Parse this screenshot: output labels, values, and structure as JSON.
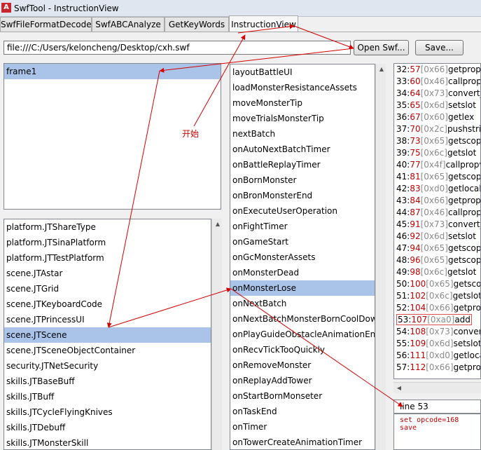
{
  "window": {
    "title": "SwfTool - InstructionView",
    "icon": "swf-app-icon"
  },
  "tabs": [
    {
      "label": "SwfFileFormatDecode",
      "active": false
    },
    {
      "label": "SwfABCAnalyze",
      "active": false
    },
    {
      "label": "GetKeyWords",
      "active": false
    },
    {
      "label": "InstructionView",
      "active": true
    }
  ],
  "toolbar": {
    "path_value": "file:///C:/Users/keloncheng/Desktop/cxh.swf",
    "open_label": "Open Swf...",
    "save_label": "Save..."
  },
  "frames": {
    "items": [
      "frame1"
    ],
    "selected_index": 0
  },
  "classes": {
    "items": [
      "platform.JTShareType",
      "platform.JTSinaPlatform",
      "platform.JTTestPlatform",
      "scene.JTAstar",
      "scene.JTGrid",
      "scene.JTKeyboardCode",
      "scene.JTPrincessUI",
      "scene.JTScene",
      "scene.JTSceneObjectContainer",
      "security.JTNetSecurity",
      "skills.JTBaseBuff",
      "skills.JTBuff",
      "skills.JTCycleFlyingKnives",
      "skills.JTDebuff",
      "skills.JTMonsterSkill"
    ],
    "selected_index": 7
  },
  "methods": {
    "items": [
      "layoutBattleUI",
      "loadMonsterResistanceAssets",
      "moveMonsterTip",
      "moveTrialsMonsterTip",
      "nextBatch",
      "onAutoNextBatchTimer",
      "onBattleReplayTimer",
      "onBornMonster",
      "onBronMonsterEnd",
      "onExecuteUserOperation",
      "onFightTimer",
      "onGameStart",
      "onGcMonsterAssets",
      "onMonsterDead",
      "onMonsterLose",
      "onNextBatch",
      "onNextBatchMonsterBornCoolDownT",
      "onPlayGuideObstacleAnimationEnd",
      "onRecvTickTooQuickly",
      "onRemoveMonster",
      "onReplayAddTower",
      "onStartBornMonseter",
      "onTaskEnd",
      "onTimer",
      "onTowerCreateAnimationTimer"
    ],
    "selected_index": 14
  },
  "instructions": [
    {
      "line": "32",
      "offset": "57",
      "opcode": "[0x66]",
      "name": "getproperty"
    },
    {
      "line": "33",
      "offset": "60",
      "opcode": "[0x46]",
      "name": "callproperty"
    },
    {
      "line": "34",
      "offset": "64",
      "opcode": "[0x73]",
      "name": "convert_i"
    },
    {
      "line": "35",
      "offset": "65",
      "opcode": "[0x6d]",
      "name": "setslot"
    },
    {
      "line": "36",
      "offset": "67",
      "opcode": "[0x60]",
      "name": "getlex"
    },
    {
      "line": "37",
      "offset": "70",
      "opcode": "[0x2c]",
      "name": "pushstring"
    },
    {
      "line": "38",
      "offset": "73",
      "opcode": "[0x65]",
      "name": "getscopeobject"
    },
    {
      "line": "39",
      "offset": "75",
      "opcode": "[0x6c]",
      "name": "getslot"
    },
    {
      "line": "40",
      "offset": "77",
      "opcode": "[0x4f]",
      "name": "callpropvoid"
    },
    {
      "line": "41",
      "offset": "81",
      "opcode": "[0x65]",
      "name": "getscopeobject"
    },
    {
      "line": "42",
      "offset": "83",
      "opcode": "[0xd0]",
      "name": "getlocal_n"
    },
    {
      "line": "43",
      "offset": "84",
      "opcode": "[0x66]",
      "name": "getproperty"
    },
    {
      "line": "44",
      "offset": "87",
      "opcode": "[0x46]",
      "name": "callproperty"
    },
    {
      "line": "45",
      "offset": "91",
      "opcode": "[0x73]",
      "name": "convert_i"
    },
    {
      "line": "46",
      "offset": "92",
      "opcode": "[0x6d]",
      "name": "setslot"
    },
    {
      "line": "47",
      "offset": "94",
      "opcode": "[0x65]",
      "name": "getscopeobject"
    },
    {
      "line": "48",
      "offset": "96",
      "opcode": "[0x65]",
      "name": "getscopeobject"
    },
    {
      "line": "49",
      "offset": "98",
      "opcode": "[0x6c]",
      "name": "getslot"
    },
    {
      "line": "50",
      "offset": "100",
      "opcode": "[0x65]",
      "name": "getscopeobject"
    },
    {
      "line": "51",
      "offset": "102",
      "opcode": "[0x6c]",
      "name": "getslot"
    },
    {
      "line": "52",
      "offset": "104",
      "opcode": "[0x66]",
      "name": "getproperty"
    },
    {
      "line": "53",
      "offset": "107",
      "opcode": "[0xa0]",
      "name": "add"
    },
    {
      "line": "54",
      "offset": "108",
      "opcode": "[0x73]",
      "name": "convert_i"
    },
    {
      "line": "55",
      "offset": "109",
      "opcode": "[0x6d]",
      "name": "setslot"
    },
    {
      "line": "56",
      "offset": "111",
      "opcode": "[0xd0]",
      "name": "getlocal_n"
    },
    {
      "line": "57",
      "offset": "112",
      "opcode": "[0x66]",
      "name": "getproperty"
    }
  ],
  "highlighted_instruction_line": "53",
  "line_display": {
    "label": "line 53"
  },
  "edit_area": {
    "lines": [
      "set opcode=168",
      "save"
    ]
  },
  "annotation": {
    "text": "开始",
    "color": "#d40000"
  }
}
